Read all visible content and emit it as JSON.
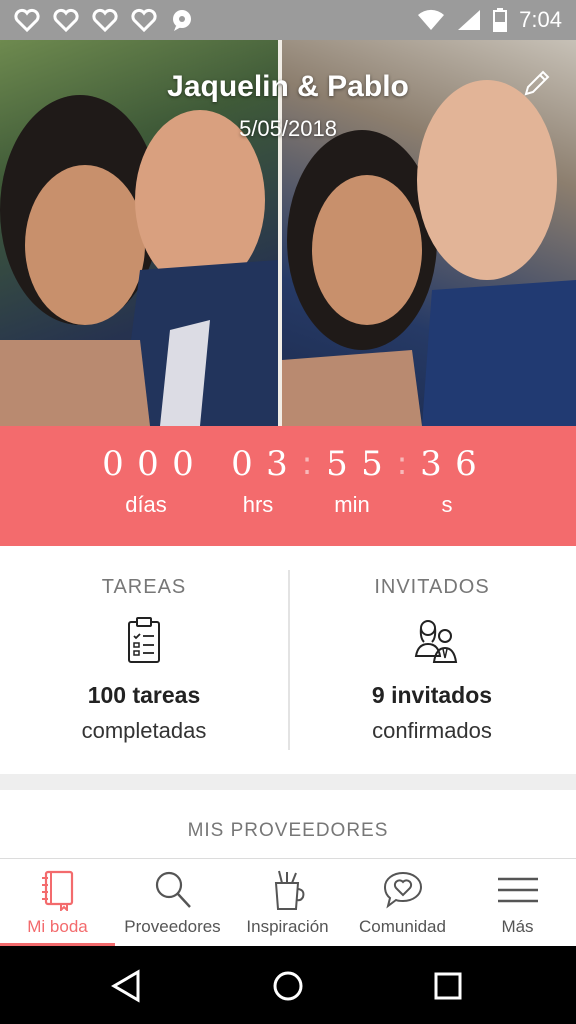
{
  "status_bar": {
    "time": "7:04",
    "notification_icons": [
      "heart-icon",
      "heart-icon",
      "heart-icon",
      "heart-icon",
      "chat-icon"
    ],
    "system_icons": [
      "wifi-icon",
      "signal-icon",
      "battery-icon"
    ]
  },
  "hero": {
    "couple_names": "Jaquelin & Pablo",
    "wedding_date": "5/05/2018",
    "edit_icon": "pencil-icon"
  },
  "countdown": {
    "digits": [
      "0",
      "0",
      "0",
      "0",
      "3",
      "5",
      "5",
      "3",
      "6"
    ],
    "labels": {
      "days": "días",
      "hours": "hrs",
      "minutes": "min",
      "seconds": "s"
    }
  },
  "stats": {
    "tasks": {
      "title": "TAREAS",
      "count": "100 tareas",
      "subtitle": "completadas",
      "icon": "clipboard-icon"
    },
    "guests": {
      "title": "INVITADOS",
      "count": "9 invitados",
      "subtitle": "confirmados",
      "icon": "couple-icon"
    }
  },
  "providers": {
    "title": "MIS PROVEEDORES"
  },
  "tabs": [
    {
      "label": "Mi boda",
      "icon": "notebook-icon",
      "active": true
    },
    {
      "label": "Proveedores",
      "icon": "search-icon",
      "active": false
    },
    {
      "label": "Inspiración",
      "icon": "cup-icon",
      "active": false
    },
    {
      "label": "Comunidad",
      "icon": "heart-bubble-icon",
      "active": false
    },
    {
      "label": "Más",
      "icon": "menu-icon",
      "active": false
    }
  ],
  "colors": {
    "accent": "#f36b6d",
    "status_bar": "#9b9b9b",
    "nav_bar": "#000000"
  }
}
